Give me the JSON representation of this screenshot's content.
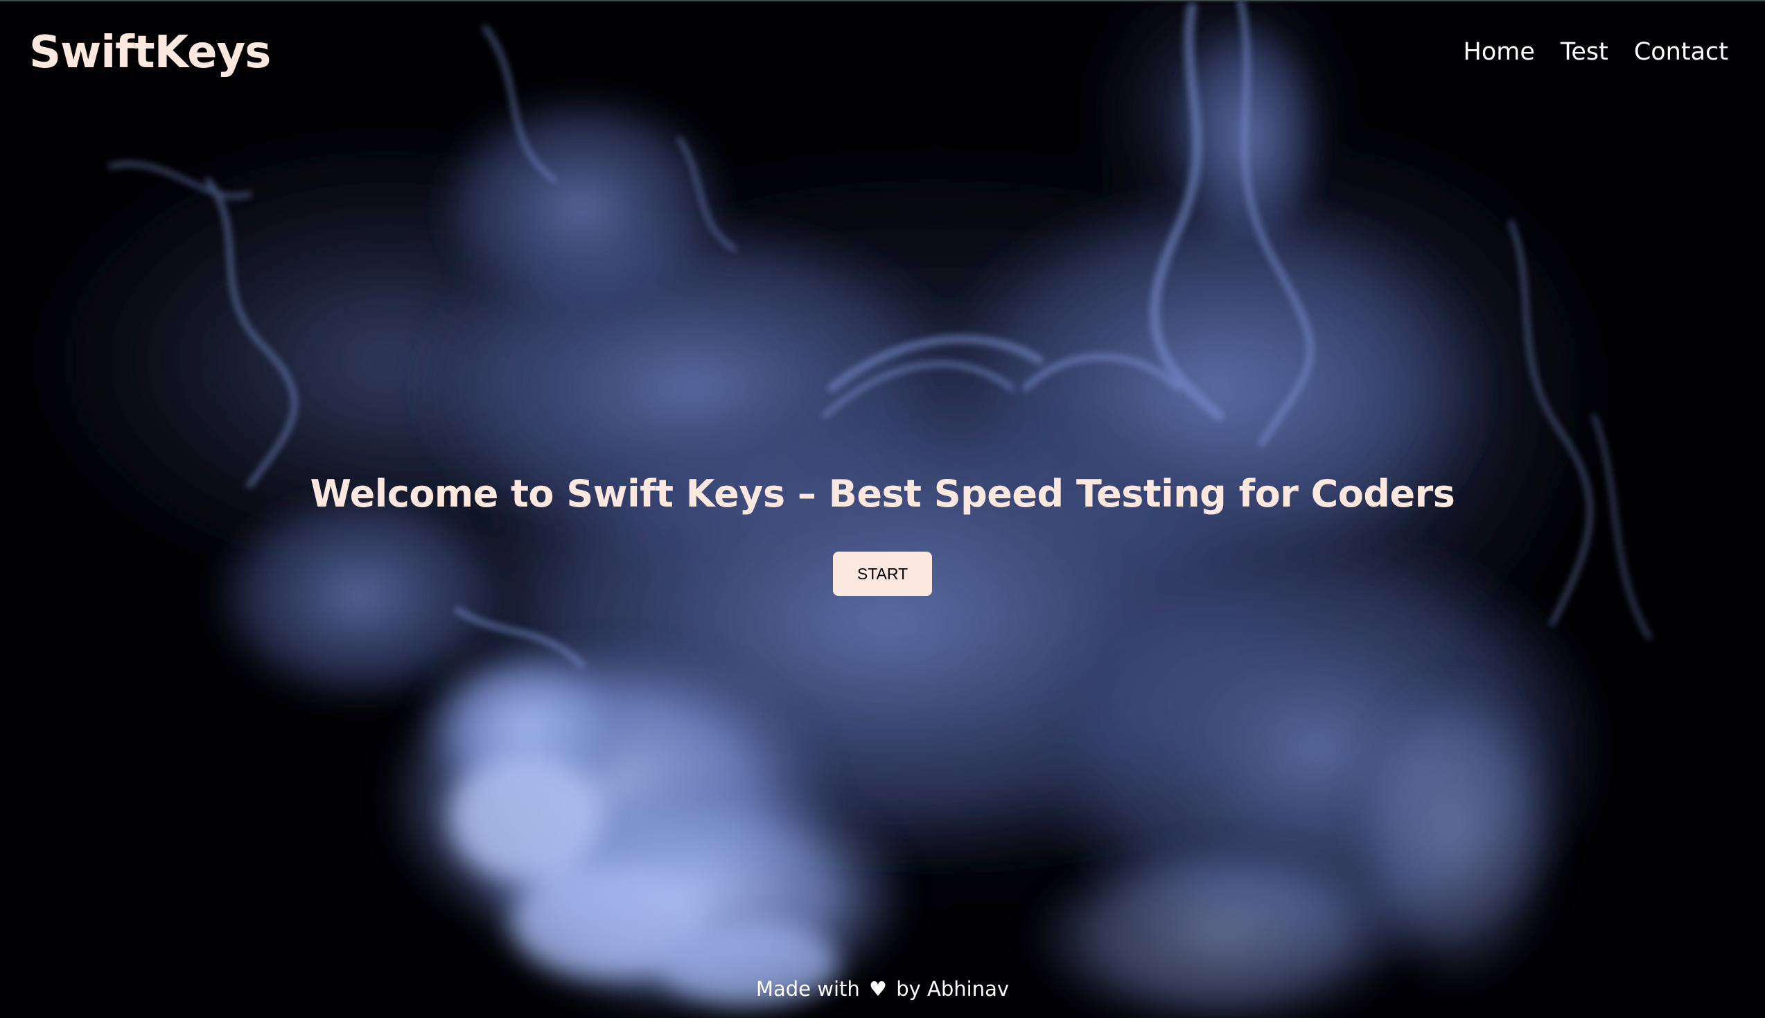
{
  "app": {
    "brand": "SwiftKeys"
  },
  "nav": {
    "items": [
      {
        "label": "Home"
      },
      {
        "label": "Test"
      },
      {
        "label": "Contact"
      }
    ]
  },
  "hero": {
    "title": "Welcome to Swift Keys – Best Speed Testing for Coders",
    "start_label": "START"
  },
  "footer": {
    "made_with": "Made with",
    "heart_icon": "heart-icon",
    "heart_glyph": "♥",
    "by_text": "by Abhinav"
  },
  "colors": {
    "background": "#020205",
    "smoke": "#8aa2e8",
    "accent_text": "#fde8e0",
    "button_bg": "#fde8e0",
    "nav_text": "#ffffff"
  }
}
